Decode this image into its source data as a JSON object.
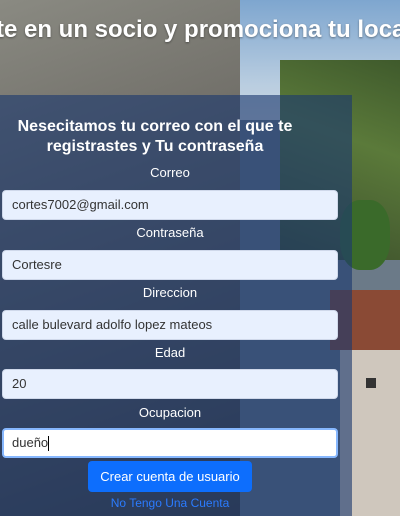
{
  "headline": "te en un socio y promociona tu local",
  "form": {
    "title_line1": "Nesecitamos tu correo con el que te",
    "title_line2": "registrastes y Tu contraseña",
    "fields": [
      {
        "label": "Correo",
        "value": "cortes7002@gmail.com"
      },
      {
        "label": "Contraseña",
        "value": "Cortesre"
      },
      {
        "label": "Direccion",
        "value": "calle bulevard adolfo lopez mateos"
      },
      {
        "label": "Edad",
        "value": "20"
      },
      {
        "label": "Ocupacion",
        "value": "dueño"
      }
    ],
    "submit_label": "Crear cuenta de usuario",
    "no_account_link": "No Tengo Una Cuenta"
  },
  "colors": {
    "panel": "#1c386e",
    "button": "#0d6efd",
    "link": "#2b7bff",
    "input_bg": "#e8f0fe"
  }
}
